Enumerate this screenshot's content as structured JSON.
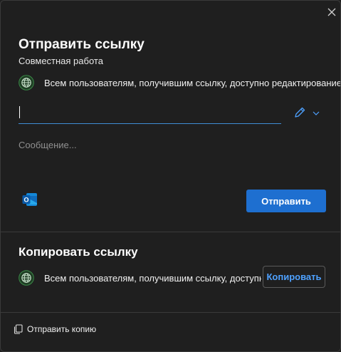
{
  "dialog": {
    "title": "Отправить ссылку",
    "subtitle": "Совместная работа"
  },
  "send_section": {
    "permission_text": "Всем пользователям, получившим ссылку, доступно редактирование",
    "to_value": "",
    "message_placeholder": "Сообщение...",
    "send_label": "Отправить",
    "outlook_icon": "outlook-icon",
    "edit_icon": "pencil-icon"
  },
  "copy_section": {
    "title": "Копировать ссылку",
    "permission_text": "Всем пользователям, получившим ссылку, доступно редактирование",
    "copy_label": "Копировать"
  },
  "footer": {
    "send_copy_label": "Отправить копию"
  },
  "colors": {
    "accent": "#1e6fd0",
    "link": "#4ea1ff",
    "background": "#1f1f1f"
  }
}
